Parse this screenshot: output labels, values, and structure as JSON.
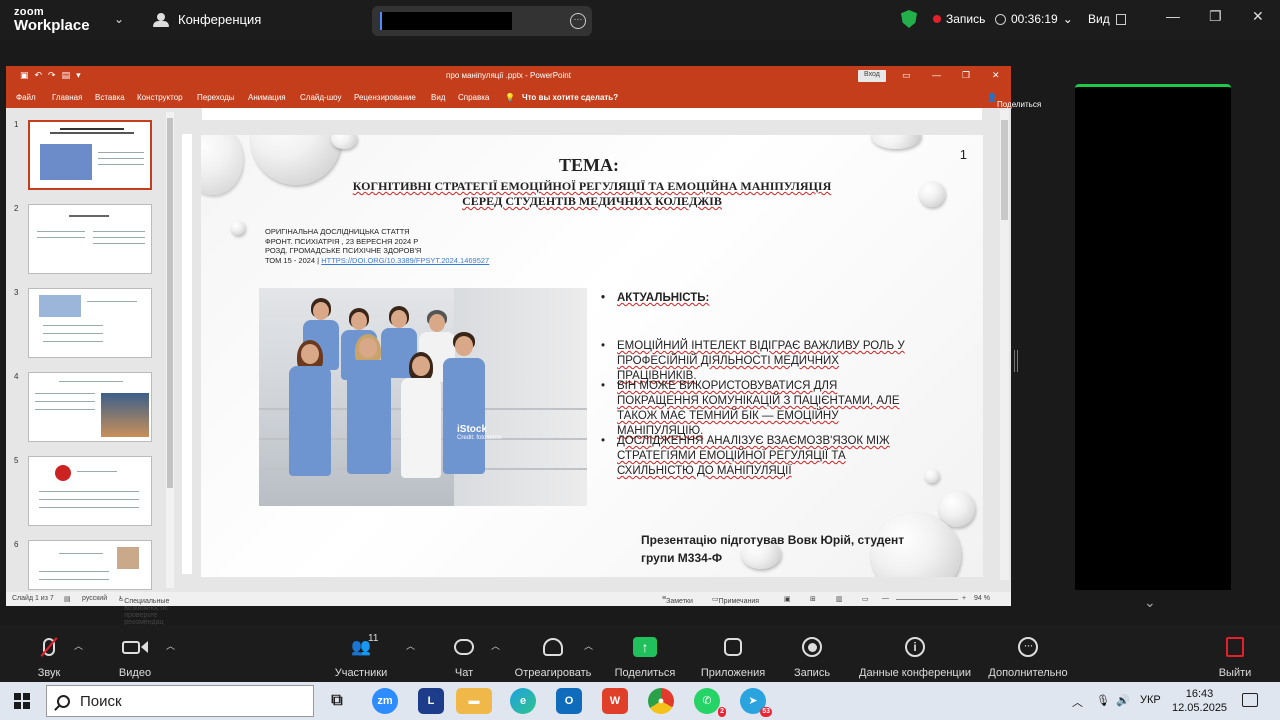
{
  "zoom": {
    "logo_line1": "zoom",
    "logo_line2": "Workplace",
    "meeting_label": "Конференция",
    "recording_label": "Запись",
    "timer": "00:36:19",
    "view_label": "Вид",
    "toolbar": {
      "audio": "Звук",
      "video": "Видео",
      "participants": "Участники",
      "participants_count": "11",
      "chat": "Чат",
      "react": "Отреагировать",
      "share": "Поделиться",
      "apps": "Приложения",
      "record": "Запись",
      "meeting_info": "Данные конференции",
      "more": "Дополнительно",
      "leave": "Выйти"
    }
  },
  "ppt": {
    "window_title": "про маніпуляції .pptx - PowerPoint",
    "login_button": "Вход",
    "ribbon_tabs": [
      "Файл",
      "Главная",
      "Вставка",
      "Конструктор",
      "Переходы",
      "Анимация",
      "Слайд-шоу",
      "Рецензирование",
      "Вид",
      "Справка"
    ],
    "tell_me": "Что вы хотите сделать?",
    "share": "Поделиться",
    "thumb_numbers": [
      "1",
      "2",
      "3",
      "4",
      "5",
      "6"
    ],
    "status": {
      "slide_of": "Слайд 1 из 7",
      "language": "русский",
      "accessibility": "Специальные возможности: проверьте рекомендац",
      "notes": "Заметки",
      "comments": "Примечания",
      "zoom": "94 %"
    },
    "slide": {
      "number": "1",
      "tema": "ТЕМА:",
      "title_line1": "КОГНІТИВНІ СТРАТЕГІЇ ЕМОЦІЙНОЇ РЕГУЛЯЦІЇ ТА ЕМОЦІЙНА МАНІПУЛЯЦІЯ",
      "title_line2": "СЕРЕД СТУДЕНТІВ МЕДИЧНИХ КОЛЕДЖІВ",
      "meta_line1": "ОРИГІНАЛЬНА ДОСЛІДНИЦЬКА СТАТТЯ",
      "meta_line2": "ФРОНТ. ПСИХІАТРІЯ , 23 ВЕРЕСНЯ 2024 Р",
      "meta_line3": "РОЗД. ГРОМАДСЬКЕ ПСИХІЧНЕ ЗДОРОВ'Я",
      "meta_line4_prefix": "ТОМ 15 - 2024 | ",
      "meta_link": "HTTPS://DOI.ORG/10.3389/FPSYT.2024.1469527",
      "photo_watermark": "iStock",
      "photo_credit": "Credit: fotostorm",
      "bullets": [
        "АКТУАЛЬНІСТЬ:",
        "ЕМОЦІЙНИЙ ІНТЕЛЕКТ ВІДІГРАЄ ВАЖЛИВУ РОЛЬ У ПРОФЕСІЙНІЙ ДІЯЛЬНОСТІ МЕДИЧНИХ ПРАЦІВНИКІВ.",
        "ВІН МОЖЕ ВИКОРИСТОВУВАТИСЯ ДЛЯ ПОКРАЩЕННЯ КОМУНІКАЦІЙ З ПАЦІЄНТАМИ, АЛЕ ТАКОЖ МАЄ ТЕМНИЙ БІК — ЕМОЦІЙНУ МАНІПУЛЯЦІЮ.",
        "ДОСЛІДЖЕННЯ АНАЛІЗУЄ ВЗАЄМОЗВ'ЯЗОК МІЖ СТРАТЕГІЯМИ ЕМОЦІЙНОЇ РЕГУЛЯЦІЇ ТА СХИЛЬНІСТЮ ДО МАНІПУЛЯЦІЇ"
      ],
      "author_line1": "Презентацію підготував Вовк Юрій, студент",
      "author_line2": "групи  М334-Ф"
    }
  },
  "taskbar": {
    "search_placeholder": "Поиск",
    "whatsapp_badge": "2",
    "telegram_badge": "53",
    "language": "УКР",
    "time": "16:43",
    "date": "12.05.2025"
  },
  "colors": {
    "ppt_accent": "#c43e1c",
    "zoom_share": "#20c05c",
    "recording": "#e5202a"
  }
}
